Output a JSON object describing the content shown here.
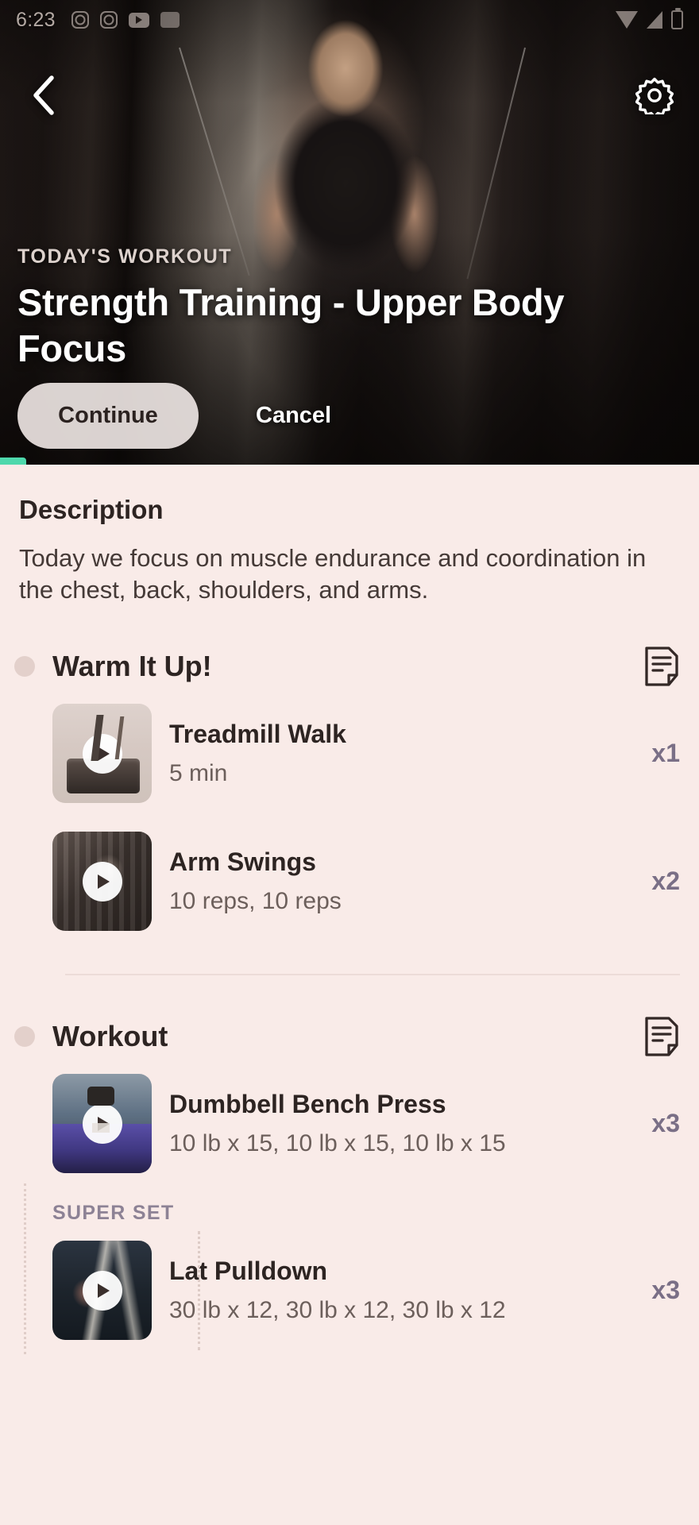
{
  "status_bar": {
    "time": "6:23",
    "left_icons": [
      "instagram-icon",
      "instagram-icon",
      "youtube-icon",
      "app-icon"
    ],
    "right_icons": [
      "wifi-icon",
      "signal-icon",
      "battery-icon"
    ]
  },
  "hero": {
    "back_icon": "back-chevron-icon",
    "settings_icon": "gear-icon",
    "eyebrow": "TODAY'S WORKOUT",
    "title": "Strength Training - Upper Body Focus",
    "continue_label": "Continue",
    "cancel_label": "Cancel",
    "progress_color": "#4ed8ac"
  },
  "description": {
    "heading": "Description",
    "body": "Today we focus on muscle endurance and coordination in the chest, back, shoulders, and arms."
  },
  "sections": [
    {
      "title": "Warm It Up!",
      "note_icon": "note-icon",
      "exercises": [
        {
          "name": "Treadmill Walk",
          "detail": "5 min",
          "count": "x1",
          "play_icon": "play-icon",
          "superset": false
        },
        {
          "name": "Arm Swings",
          "detail": "10 reps, 10 reps",
          "count": "x2",
          "play_icon": "play-icon",
          "superset": false
        }
      ]
    },
    {
      "title": "Workout",
      "note_icon": "note-icon",
      "superset_label": "SUPER SET",
      "exercises": [
        {
          "name": "Dumbbell Bench Press",
          "detail": "10 lb x 15, 10 lb x 15, 10 lb x 15",
          "count": "x3",
          "play_icon": "play-icon",
          "superset": false
        },
        {
          "name": "Lat Pulldown",
          "detail": "30 lb x 12, 30 lb x 12, 30 lb x 12",
          "count": "x3",
          "play_icon": "play-icon",
          "superset": true
        }
      ]
    }
  ],
  "colors": {
    "background": "#f9ebe8",
    "text_primary": "#2d2422",
    "text_secondary": "#6c5f5b",
    "count_accent": "#7a6f86",
    "progress": "#4ed8ac"
  }
}
